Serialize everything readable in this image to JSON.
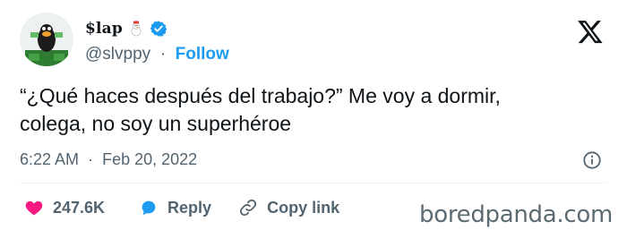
{
  "user": {
    "display_name": "$lap",
    "handle": "@slvppy",
    "separator": "·",
    "follow_label": "Follow"
  },
  "tweet": {
    "text_line1": "“¿Qué haces después del trabajo?” Me voy a dormir,",
    "text_line2": "colega, no soy un superhéroe",
    "time": "6:22 AM",
    "date": "Feb 20, 2022"
  },
  "actions": {
    "like_count": "247.6K",
    "reply_label": "Reply",
    "copy_link_label": "Copy link"
  },
  "watermark": "boredpanda.com",
  "colors": {
    "accent": "#1d9bf0",
    "like": "#f91880",
    "muted": "#536471"
  },
  "icons": [
    "verified-icon",
    "x-logo-icon",
    "info-icon",
    "heart-icon",
    "reply-bubble-icon",
    "link-icon"
  ]
}
